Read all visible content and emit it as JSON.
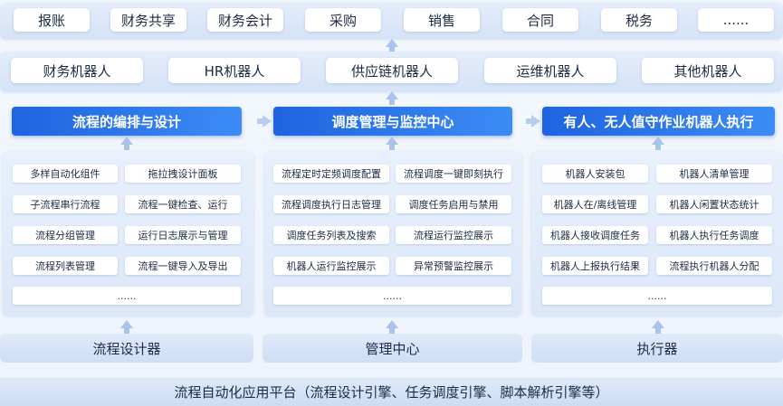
{
  "top_row": [
    "报账",
    "财务共享",
    "财务会计",
    "采购",
    "销售",
    "合同",
    "税务",
    "......"
  ],
  "robots": [
    "财务机器人",
    "HR机器人",
    "供应链机器人",
    "运维机器人",
    "其他机器人"
  ],
  "columns": [
    {
      "header": "流程的编排与设计",
      "items": [
        "多样自动化组件",
        "拖拉拽设计面板",
        "子流程串行流程",
        "流程一键检查、运行",
        "流程分组管理",
        "运行日志展示与管理",
        "流程列表管理",
        "流程一键导入及导出"
      ],
      "more": "......",
      "engine": "流程设计器"
    },
    {
      "header": "调度管理与监控中心",
      "items": [
        "流程定时定频调度配置",
        "流程调度一键即刻执行",
        "流程调度执行日志管理",
        "调度任务启用与禁用",
        "调度任务列表及搜索",
        "流程运行监控展示",
        "机器人运行监控展示",
        "异常预警监控展示"
      ],
      "more": "......",
      "engine": "管理中心"
    },
    {
      "header": "有人、无人值守作业机器人执行",
      "items": [
        "机器人安装包",
        "机器人清单管理",
        "机器人在/离线管理",
        "机器人闲置状态统计",
        "机器人接收调度任务",
        "机器人执行任务调度",
        "机器人上报执行结果",
        "流程执行机器人分配"
      ],
      "more": "......",
      "engine": "执行器"
    }
  ],
  "platform": "流程自动化应用平台（流程设计引擎、任务调度引擎、脚本解析引擎等）"
}
